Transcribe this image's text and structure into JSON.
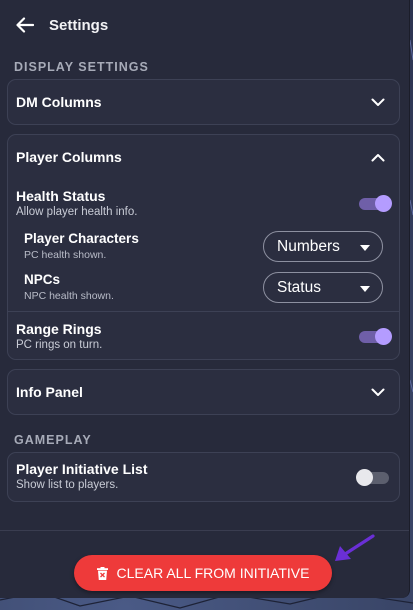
{
  "header": {
    "title": "Settings",
    "back_icon": "arrow-left-icon"
  },
  "sections": {
    "display": "DISPLAY SETTINGS",
    "gameplay": "GAMEPLAY"
  },
  "dm_columns": {
    "title": "DM Columns",
    "expanded": false
  },
  "player_columns": {
    "title": "Player Columns",
    "expanded": true,
    "health_status": {
      "title": "Health Status",
      "subtitle": "Allow player health info.",
      "enabled": true
    },
    "player_characters": {
      "title": "Player Characters",
      "subtitle": "PC health shown.",
      "selected": "Numbers"
    },
    "npcs": {
      "title": "NPCs",
      "subtitle": "NPC health shown.",
      "selected": "Status"
    },
    "range_rings": {
      "title": "Range Rings",
      "subtitle": "PC rings on turn.",
      "enabled": true
    }
  },
  "info_panel": {
    "title": "Info Panel",
    "expanded": false
  },
  "player_initiative": {
    "title": "Player Initiative List",
    "subtitle": "Show list to players.",
    "enabled": false
  },
  "footer": {
    "clear_button": "CLEAR ALL FROM INITIATIVE",
    "clear_icon": "trash-icon"
  },
  "colors": {
    "panel": "#272a3b",
    "card": "#2b2e40",
    "accent": "#b49cff",
    "danger": "#ee3a3a",
    "pointer": "#6a2fd6"
  }
}
